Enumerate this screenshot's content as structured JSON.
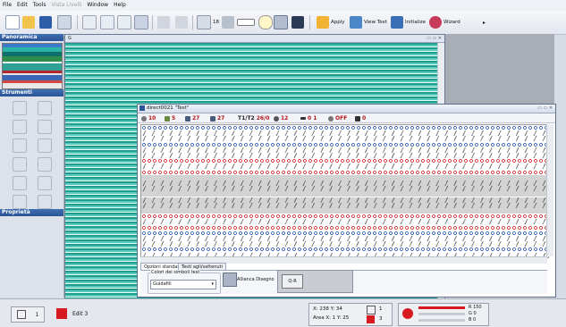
{
  "menu": [
    "File",
    "Edit",
    "Tools",
    "Vista Livelli",
    "Window",
    "Help"
  ],
  "toolbar": {
    "zoom_label": "18",
    "apply_label": "Apply",
    "view_text_label": "View Text",
    "initialize_label": "Initialize",
    "wizard_label": "Wizard"
  },
  "left_panels": {
    "panoramic": "Panoramica",
    "tools": "Strumenti",
    "properties": "Proprietà"
  },
  "window_back": {
    "title": "G"
  },
  "window_front": {
    "title": "direct0021 \"Test\"",
    "stats": {
      "s1": "10",
      "s2": "5",
      "s3": "27",
      "s4": "27",
      "t_label": "T1/T2",
      "t_value": "26/0",
      "s5": "12",
      "s6": "0 1",
      "off": "OFF",
      "s7": "0"
    },
    "tabs": [
      "Opzioni standard",
      "Testi agli/sattenuti"
    ],
    "group_label": "Colori dei simboli test",
    "select_value": "Guidafili",
    "btn1_label": "Allianca Disegno",
    "btn2_label": "Q-R"
  },
  "status": {
    "left_value": "1",
    "edit_value": "Edit 3",
    "coords": "X: 238  Y: 34",
    "area": "Area X: 1  Y: 25",
    "val1": "1",
    "val2": "3",
    "r": "R 150",
    "g": "G 0",
    "b": "B 0"
  },
  "colors": {
    "accent": "#2a5496",
    "red": "#d71920",
    "teal": "#1f9e8e"
  }
}
